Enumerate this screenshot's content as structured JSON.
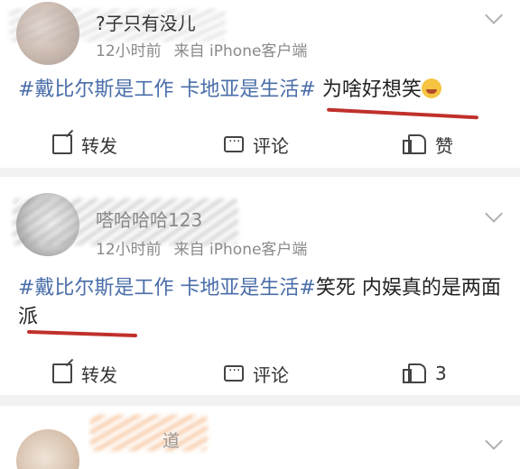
{
  "posts": [
    {
      "username": "?子只有没儿",
      "time": "12小时前",
      "source": "来自 iPhone客户端",
      "topic": "#戴比尔斯是工作 卡地亚是生活#",
      "text": "为啥好想笑",
      "actions": {
        "forward": "转发",
        "comment": "评论",
        "like": "赞"
      }
    },
    {
      "username": "嗒哈哈哈123",
      "time": "12小时前",
      "source": "来自 iPhone客户端",
      "topic": "#戴比尔斯是工作 卡地亚是生活#",
      "text": "笑死 内娱真的是两面派",
      "actions": {
        "forward": "转发",
        "comment": "评论",
        "like": "3"
      }
    },
    {
      "username": "道"
    }
  ],
  "icons": [
    "forward-icon",
    "comment-icon",
    "like-icon",
    "chevron-down-icon",
    "laughing-emoji-icon"
  ],
  "colors": {
    "topic": "#4a6ea9",
    "underline": "#c0302b",
    "background": "#f2f2f2"
  }
}
